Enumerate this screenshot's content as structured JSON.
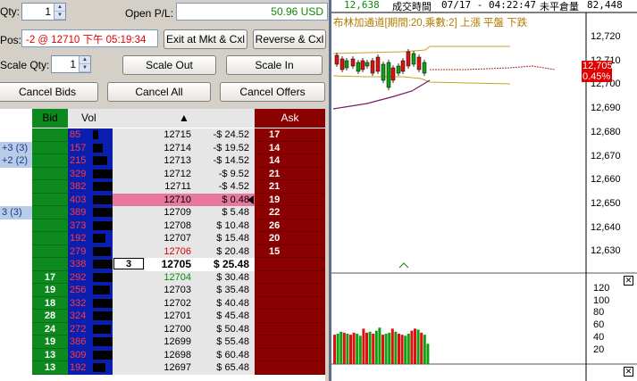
{
  "controls": {
    "qty_label": "Qty:",
    "qty_value": "1",
    "open_pl_label": "Open P/L:",
    "open_pl_value": "50.96 USD",
    "pos_label": "Pos:",
    "pos_value": "-2 @ 12710 下午 05:19:34",
    "scale_qty_label": "Scale Qty:",
    "scale_qty_value": "1",
    "exit_button": "Exit at Mkt & Cxl",
    "reverse_button": "Reverse & Cxl",
    "scale_out_button": "Scale Out",
    "scale_in_button": "Scale In",
    "cancel_bids_button": "Cancel Bids",
    "cancel_all_button": "Cancel All",
    "cancel_offers_button": "Cancel Offers",
    "spin_up_icon": "arrow-up-icon",
    "spin_down_icon": "arrow-down-icon"
  },
  "ladder": {
    "headers": {
      "bid": "Bid",
      "vol": "Vol",
      "sort": "▲",
      "ask": "Ask"
    },
    "rows": [
      {
        "left": "",
        "bid": "",
        "vol": "85",
        "vol_frac": 0.28,
        "q": "",
        "price": "12715",
        "pnl": "-$ 24.52",
        "ask": "17"
      },
      {
        "left": "+3 (3)",
        "bid": "",
        "vol": "157",
        "vol_frac": 0.52,
        "q": "",
        "price": "12714",
        "pnl": "-$ 19.52",
        "ask": "14"
      },
      {
        "left": "+2 (2)",
        "bid": "",
        "vol": "215",
        "vol_frac": 0.72,
        "q": "",
        "price": "12713",
        "pnl": "-$ 14.52",
        "ask": "14"
      },
      {
        "left": "",
        "bid": "",
        "vol": "329",
        "vol_frac": 1.0,
        "q": "",
        "price": "12712",
        "pnl": "-$ 9.52",
        "ask": "21"
      },
      {
        "left": "",
        "bid": "",
        "vol": "382",
        "vol_frac": 1.0,
        "q": "",
        "price": "12711",
        "pnl": "-$ 4.52",
        "ask": "21"
      },
      {
        "left": "",
        "bid": "",
        "vol": "403",
        "vol_frac": 1.0,
        "q": "",
        "price": "12710",
        "pnl": "$ 0.48",
        "ask": "19"
      },
      {
        "left": "3 (3)",
        "bid": "",
        "vol": "389",
        "vol_frac": 1.0,
        "q": "",
        "price": "12709",
        "pnl": "$ 5.48",
        "ask": "22"
      },
      {
        "left": "",
        "bid": "",
        "vol": "373",
        "vol_frac": 1.0,
        "q": "",
        "price": "12708",
        "pnl": "$ 10.48",
        "ask": "26"
      },
      {
        "left": "",
        "bid": "",
        "vol": "192",
        "vol_frac": 0.64,
        "q": "",
        "price": "12707",
        "pnl": "$ 15.48",
        "ask": "20"
      },
      {
        "left": "",
        "bid": "",
        "vol": "279",
        "vol_frac": 0.93,
        "q": "",
        "price": "12706",
        "pnl": "$ 20.48",
        "ask": "15"
      },
      {
        "left": "",
        "bid": "",
        "vol": "338",
        "vol_frac": 1.0,
        "q": "3",
        "price": "12705",
        "pnl": "$ 25.48",
        "ask": ""
      },
      {
        "left": "",
        "bid": "17",
        "vol": "292",
        "vol_frac": 1.0,
        "q": "",
        "price": "12704",
        "pnl": "$ 30.48",
        "ask": ""
      },
      {
        "left": "",
        "bid": "19",
        "vol": "256",
        "vol_frac": 0.85,
        "q": "",
        "price": "12703",
        "pnl": "$ 35.48",
        "ask": ""
      },
      {
        "left": "",
        "bid": "18",
        "vol": "332",
        "vol_frac": 1.0,
        "q": "",
        "price": "12702",
        "pnl": "$ 40.48",
        "ask": ""
      },
      {
        "left": "",
        "bid": "28",
        "vol": "324",
        "vol_frac": 1.0,
        "q": "",
        "price": "12701",
        "pnl": "$ 45.48",
        "ask": ""
      },
      {
        "left": "",
        "bid": "24",
        "vol": "272",
        "vol_frac": 0.9,
        "q": "",
        "price": "12700",
        "pnl": "$ 50.48",
        "ask": ""
      },
      {
        "left": "",
        "bid": "19",
        "vol": "386",
        "vol_frac": 1.0,
        "q": "",
        "price": "12699",
        "pnl": "$ 55.48",
        "ask": ""
      },
      {
        "left": "",
        "bid": "13",
        "vol": "309",
        "vol_frac": 1.0,
        "q": "",
        "price": "12698",
        "pnl": "$ 60.48",
        "ask": ""
      },
      {
        "left": "",
        "bid": "13",
        "vol": "192",
        "vol_frac": 0.64,
        "q": "",
        "price": "12697",
        "pnl": "$ 65.48",
        "ask": ""
      }
    ],
    "highlight_price": "12710",
    "current_price": "12705",
    "red_price": "12706",
    "green_price": "12704"
  },
  "chart": {
    "info_last": "12,638",
    "info_label": "成交時間",
    "info_time": "07/17 - 04:22:47",
    "info_label2": "未平倉量",
    "info_oi": "82,448",
    "bb_label": "布林加通道[期間:20,乘數:2] 上漲  平盤  下跌",
    "price_axis": [
      "12,720",
      "12,710",
      "12,700",
      "12,690",
      "12,680",
      "12,670",
      "12,660",
      "12,650",
      "12,640",
      "12,630"
    ],
    "price_tag": "12,705",
    "pct_tag": "0.45%",
    "vol_axis": [
      "120",
      "100",
      "80",
      "60",
      "40",
      "20"
    ],
    "close_icon": "close-icon",
    "colors": {
      "up": "#e01010",
      "down": "#10a010",
      "band": "#c8a020",
      "ma": "#7a1a6a"
    }
  }
}
